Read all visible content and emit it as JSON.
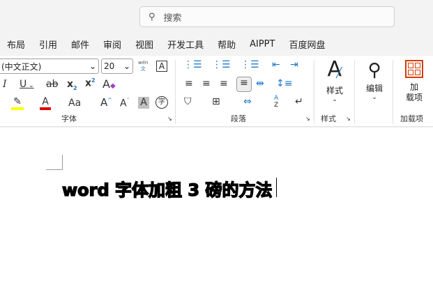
{
  "search": {
    "placeholder": "搜索",
    "icon": "search-icon"
  },
  "menu": [
    "布局",
    "引用",
    "邮件",
    "审阅",
    "视图",
    "开发工具",
    "帮助",
    "AIPPT",
    "百度网盘"
  ],
  "font": {
    "name": "(中文正文)",
    "size": "20",
    "phonetic_top": "wén",
    "phonetic_bottom": "文",
    "border_char": "A",
    "clear_label": "A",
    "case_label": "Aa",
    "grow": "A",
    "shrink": "A",
    "shade": "A",
    "enclose": "字",
    "group_label": "字体",
    "highlight_color": "#ffff00",
    "font_color": "#e00000"
  },
  "paragraph": {
    "group_label": "段落",
    "sort_a": "A",
    "sort_z": "Z"
  },
  "styles": {
    "label": "样式",
    "group_label": "样式"
  },
  "editing": {
    "label": "编辑"
  },
  "addins": {
    "label": "加载项",
    "label_line1": "加",
    "label_line2": "载项",
    "group_label": "加载项",
    "color": "#d83b01"
  },
  "document": {
    "text": "word 字体加粗 3 磅的方法"
  }
}
